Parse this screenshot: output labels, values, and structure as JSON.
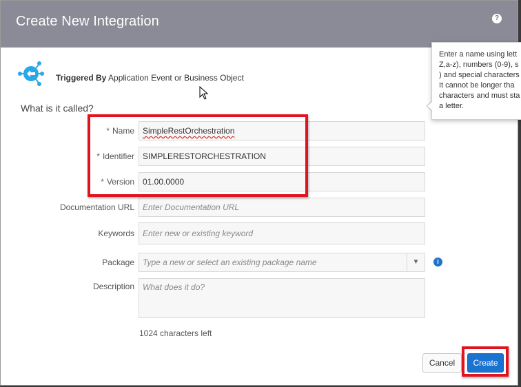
{
  "dialog": {
    "title": "Create New Integration",
    "help_glyph": "?"
  },
  "trigger": {
    "icon": "app-event-icon",
    "label_bold": "Triggered By",
    "label_rest": "Application Event or Business Object"
  },
  "question": "What is it called?",
  "form": {
    "name": {
      "label": "Name",
      "required": "*",
      "value": "SimpleRestOrchestration"
    },
    "identifier": {
      "label": "Identifier",
      "required": "*",
      "value": "SIMPLERESTORCHESTRATION"
    },
    "version": {
      "label": "Version",
      "required": "*",
      "value": "01.00.0000"
    },
    "documentation_url": {
      "label": "Documentation URL",
      "placeholder": "Enter Documentation URL"
    },
    "keywords": {
      "label": "Keywords",
      "placeholder": "Enter new or existing keyword"
    },
    "package": {
      "label": "Package",
      "placeholder": "Type a new or select an existing package name",
      "arrow": "▼",
      "info_glyph": "i"
    },
    "description": {
      "label": "Description",
      "placeholder": "What does it do?"
    },
    "chars_left": "1024 characters left"
  },
  "tooltip": {
    "lines": [
      "Enter a name using lett",
      "Z,a-z), numbers (0-9), s",
      ") and special characters",
      "It cannot be longer tha",
      "characters and must sta",
      "a letter."
    ]
  },
  "buttons": {
    "cancel": "Cancel",
    "create": "Create"
  },
  "colors": {
    "header_bg": "#8b8b97",
    "primary": "#1a73d0",
    "highlight": "#e1131e",
    "trigger_icon": "#2aa7e6"
  }
}
